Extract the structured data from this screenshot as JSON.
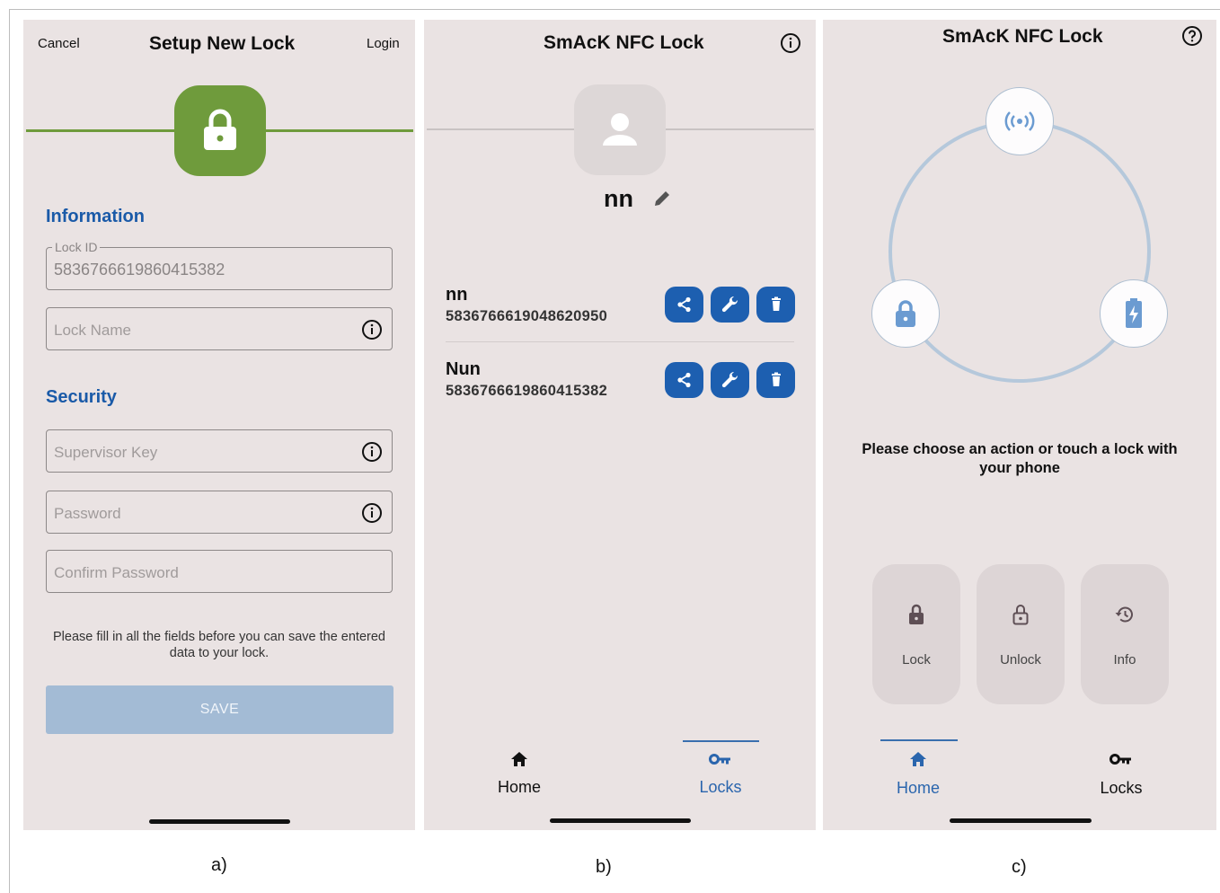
{
  "panels": {
    "a": {
      "caption": "a)",
      "nav": {
        "cancel": "Cancel",
        "title": "Setup New Lock",
        "login": "Login"
      },
      "information_heading": "Information",
      "lock_id": {
        "label": "Lock ID",
        "value": "5836766619860415382"
      },
      "lock_name": {
        "placeholder": "Lock Name"
      },
      "security_heading": "Security",
      "supervisor_key": {
        "placeholder": "Supervisor Key"
      },
      "password": {
        "placeholder": "Password"
      },
      "confirm_password": {
        "placeholder": "Confirm Password"
      },
      "helper_text": "Please fill in all the fields before you can save the entered data to your lock.",
      "save_label": "SAVE",
      "colors": {
        "accent": "#6f9b3c",
        "save_disabled": "#a3bbd5"
      }
    },
    "b": {
      "caption": "b)",
      "title": "SmAcK NFC Lock",
      "profile_name": "nn",
      "locks": [
        {
          "name": "nn",
          "id": "5836766619048620950"
        },
        {
          "name": "Nun",
          "id": "5836766619860415382"
        }
      ],
      "tabs": [
        {
          "label": "Home",
          "active": false
        },
        {
          "label": "Locks",
          "active": true
        }
      ],
      "colors": {
        "action_button": "#1d5fb0",
        "tab_active": "#3a6fae"
      }
    },
    "c": {
      "caption": "c)",
      "title": "SmAcK NFC Lock",
      "prompt": "Please choose an action or touch a lock with your phone",
      "actions": [
        {
          "label": "Lock",
          "icon": "lock-closed-icon"
        },
        {
          "label": "Unlock",
          "icon": "lock-open-icon"
        },
        {
          "label": "Info",
          "icon": "history-icon"
        }
      ],
      "tabs": [
        {
          "label": "Home",
          "active": true
        },
        {
          "label": "Locks",
          "active": false
        }
      ],
      "colors": {
        "ring": "#b5c8db",
        "icon_blue": "#6b9bd1"
      }
    }
  }
}
